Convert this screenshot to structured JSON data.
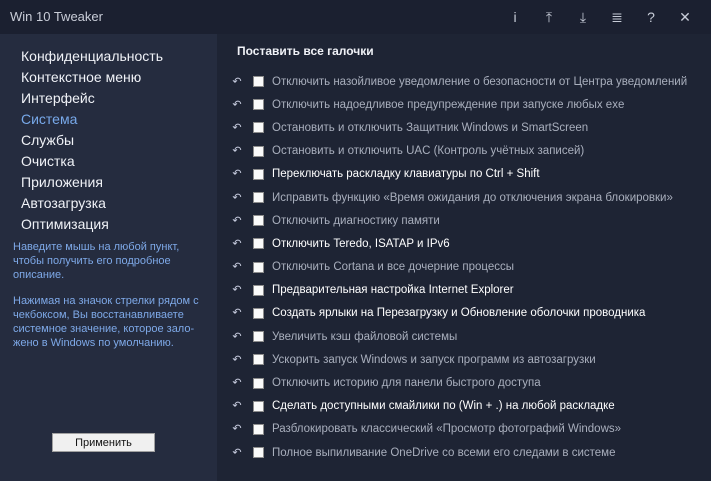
{
  "window": {
    "title": "Win 10 Tweaker"
  },
  "titlebar_icons": [
    "info-icon",
    "upload-icon",
    "download-icon",
    "list-undo-icon",
    "help-icon",
    "close-icon"
  ],
  "titlebar_glyphs": {
    "info": "i",
    "upload": "⤒",
    "download": "⤓",
    "list": "≣",
    "help": "?",
    "close": "✕"
  },
  "sidebar": {
    "items": [
      {
        "label": "Конфиденциальность"
      },
      {
        "label": "Контекстное меню"
      },
      {
        "label": "Интерфейс"
      },
      {
        "label": "Система"
      },
      {
        "label": "Службы"
      },
      {
        "label": "Очистка"
      },
      {
        "label": "Приложения"
      },
      {
        "label": "Автозагрузка"
      },
      {
        "label": "Оптимизация"
      }
    ],
    "hint1": "Наведите мышь на любой пункт, чтобы получить его подробное описание.",
    "hint2": "Нажимая на значок стрелки рядом с чекбоксом, Вы восстанавливаете системное значение, которое зало-жено в Windows по умолчанию.",
    "apply_label": "Применить"
  },
  "main": {
    "select_all_label": "Поставить все галочки",
    "options": [
      {
        "label": "Отключить назойливое уведомление о безопасности от Центра уведомлений"
      },
      {
        "label": "Отключить надоедливое предупреждение при запуске любых exe"
      },
      {
        "label": "Остановить и отключить Защитник Windows и SmartScreen"
      },
      {
        "label": "Остановить и отключить UAC (Контроль учётных записей)"
      },
      {
        "label": "Переключать раскладку клавиатуры по Ctrl + Shift"
      },
      {
        "label": "Исправить функцию «Время ожидания до отключения экрана блокировки»"
      },
      {
        "label": "Отключить диагностику памяти"
      },
      {
        "label": "Отключить Teredo, ISATAP и IPv6"
      },
      {
        "label": "Отключить Cortana и все дочерние процессы"
      },
      {
        "label": "Предварительная настройка Internet Explorer"
      },
      {
        "label": "Создать ярлыки на Перезагрузку и Обновление оболочки проводника"
      },
      {
        "label": "Увеличить кэш файловой системы"
      },
      {
        "label": "Ускорить запуск Windows и запуск программ из автозагрузки"
      },
      {
        "label": "Отключить историю для панели быстрого доступа"
      },
      {
        "label": "Сделать доступными смайлики по (Win + .) на любой раскладке"
      },
      {
        "label": "Разблокировать классический «Просмотр фотографий Windows»"
      },
      {
        "label": "Полное выпиливание OneDrive со всеми его следами в системе"
      }
    ],
    "arrow_glyph": "↶"
  },
  "colors": {
    "active_nav": "#78a9ea",
    "hint": "#7ea9e8",
    "bg": "#1e2434",
    "sidebar_bg": "#252c3f"
  }
}
